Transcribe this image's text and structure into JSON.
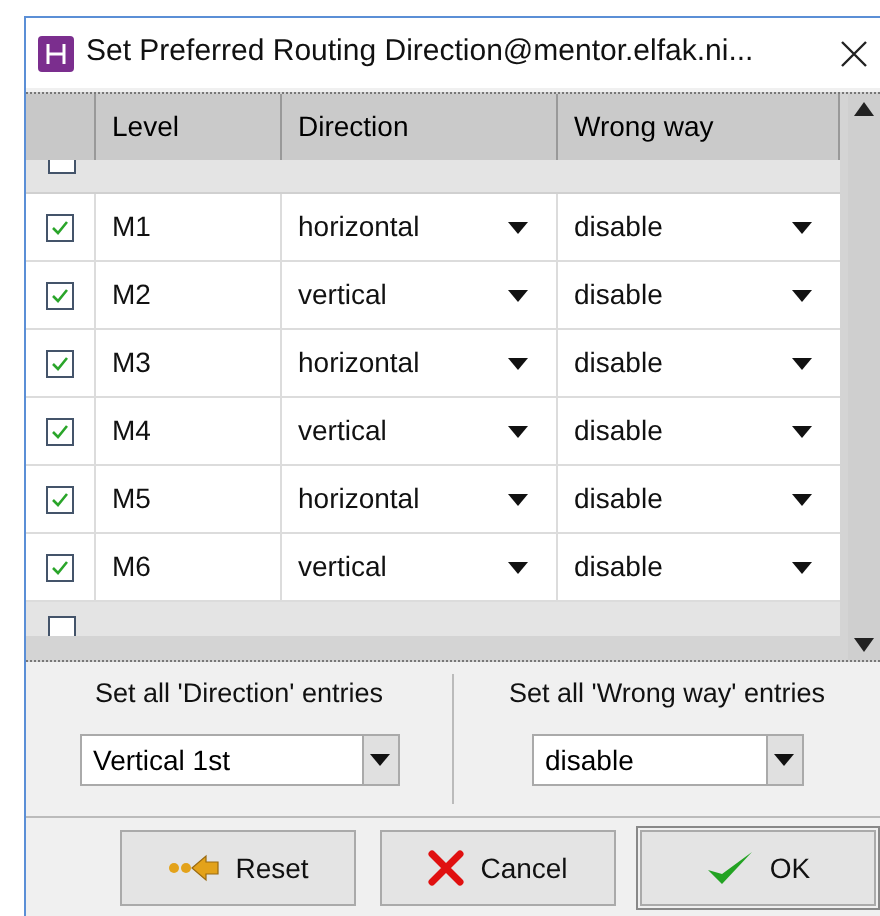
{
  "window": {
    "title": "Set Preferred Routing Direction@mentor.elfak.ni..."
  },
  "table": {
    "columns": [
      "Level",
      "Direction",
      "Wrong way"
    ],
    "top_clipped_row": {
      "checked": false
    },
    "rows": [
      {
        "checked": true,
        "level": "M1",
        "direction": "horizontal",
        "wrong_way": "disable"
      },
      {
        "checked": true,
        "level": "M2",
        "direction": "vertical",
        "wrong_way": "disable"
      },
      {
        "checked": true,
        "level": "M3",
        "direction": "horizontal",
        "wrong_way": "disable"
      },
      {
        "checked": true,
        "level": "M4",
        "direction": "vertical",
        "wrong_way": "disable"
      },
      {
        "checked": true,
        "level": "M5",
        "direction": "horizontal",
        "wrong_way": "disable"
      },
      {
        "checked": true,
        "level": "M6",
        "direction": "vertical",
        "wrong_way": "disable"
      }
    ],
    "bottom_clipped_row": {
      "checked": false
    }
  },
  "set_all": [
    {
      "label": "Set all 'Direction' entries",
      "value": "Vertical 1st"
    },
    {
      "label": "Set all 'Wrong way' entries",
      "value": "disable"
    }
  ],
  "buttons": [
    {
      "kind": "reset",
      "label": "Reset"
    },
    {
      "kind": "cancel",
      "label": "Cancel"
    },
    {
      "kind": "ok",
      "label": "OK"
    }
  ]
}
